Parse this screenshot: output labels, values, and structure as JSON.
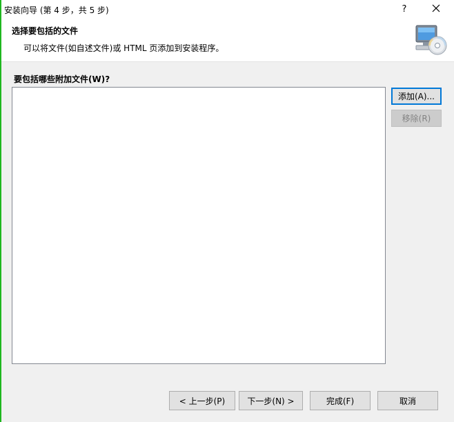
{
  "window": {
    "title": "安装向导 (第 4 步，共 5 步)",
    "help_glyph": "?",
    "close_glyph": "×"
  },
  "header": {
    "title": "选择要包括的文件",
    "subtitle": "可以将文件(如自述文件)或 HTML 页添加到安装程序。",
    "icon": "setup-computer-cd-icon"
  },
  "main": {
    "list_label": "要包括哪些附加文件(W)?",
    "files": []
  },
  "side_buttons": {
    "add_label": "添加(A)...",
    "remove_label": "移除(R)"
  },
  "footer": {
    "back_label": "< 上一步(P)",
    "next_label": "下一步(N) >",
    "finish_label": "完成(F)",
    "cancel_label": "取消"
  },
  "colors": {
    "accent": "#0078d7",
    "side_strip": "#1fb71f"
  }
}
